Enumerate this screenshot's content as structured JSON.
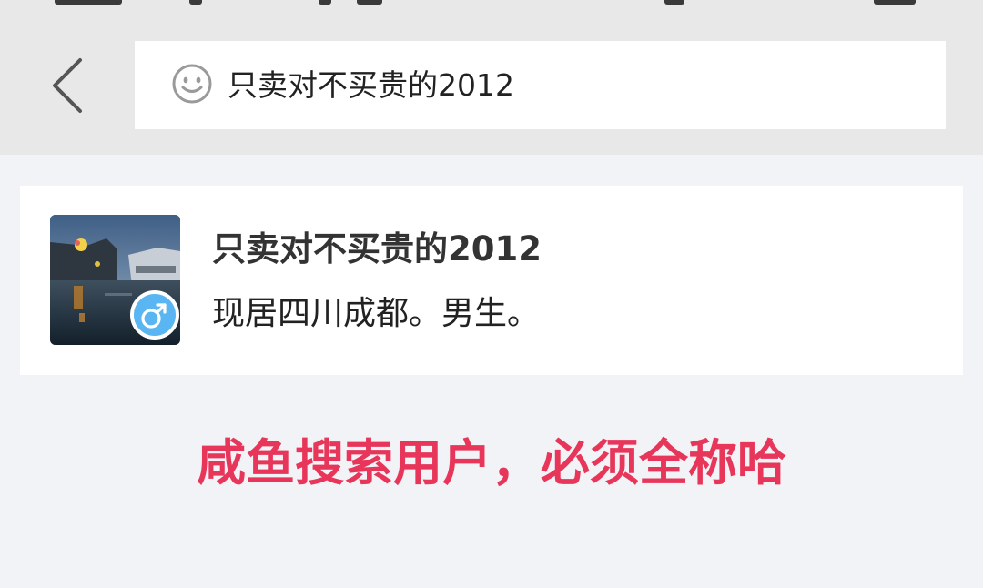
{
  "search": {
    "query": "只卖对不买贵的2012"
  },
  "result": {
    "name": "只卖对不买贵的2012",
    "bio": "现居四川成都。男生。",
    "gender": "male"
  },
  "caption": "咸鱼搜索用户，必须全称哈",
  "colors": {
    "header_bg": "#e8e8e8",
    "page_bg": "#f2f3f7",
    "caption": "#e8365a",
    "gender_badge": "#5ab6f2"
  }
}
